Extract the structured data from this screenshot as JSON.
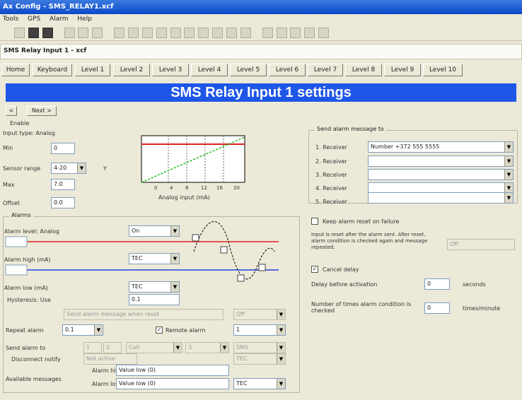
{
  "window": {
    "title": "Ax Config - SMS_RELAY1.xcf"
  },
  "menu": [
    "Tools",
    "GPS",
    "Alarm",
    "Help"
  ],
  "path_text": "SMS Relay Input 1 - xcf",
  "tabs": [
    "Home",
    "Keyboard",
    "Level 1",
    "Level 2",
    "Level 3",
    "Level 4",
    "Level 5",
    "Level 6",
    "Level 7",
    "Level 8",
    "Level 9",
    "Level 10"
  ],
  "banner": "SMS Relay Input 1 settings",
  "nav": {
    "prev": "<",
    "next": "Next >"
  },
  "left": {
    "enable_label": "Enable",
    "type_label": "Input type: Analog",
    "scale": [
      {
        "label": "Min",
        "value": "0"
      },
      {
        "label": "Sensor range",
        "value": "4-20"
      },
      {
        "label": "Max",
        "value": "7.0"
      },
      {
        "label": "Offset",
        "value": "0.0"
      }
    ],
    "graph": {
      "xlabel": "Analog input (mA)",
      "ylabel": "Y",
      "xticks": [
        "0",
        "4",
        "8",
        "12",
        "16",
        "20"
      ]
    }
  },
  "alarms": {
    "title": "Alarms",
    "mode_label": "Alarm level: Analog",
    "mode_value": "On",
    "high_label": "Alarm high (mA)",
    "high_delay": "TEC",
    "low_label": "Alarm low (mA)",
    "low_delay": "TEC",
    "hysteresis_label": "Hysteresis: Use",
    "hysteresis_value": "0.1",
    "disabled_msg": "Send alarm message when reset",
    "disabled_val": "Off",
    "repeat_label": "Repeat alarm",
    "repeat_value": "0.1",
    "remote_label": "Remote alarm",
    "remote_value": "1",
    "send_label": "Send alarm to",
    "send_options": [
      "1",
      "2",
      "Call",
      "3",
      "SMS"
    ],
    "notify_label": "Disconnect notify",
    "notify_value": "Not active",
    "notify_extra": "TEC",
    "msg_label": "Available messages",
    "msg_high_label": "Alarm high",
    "msg_high": "Value low (0)",
    "msg_low_label": "Alarm low",
    "msg_low": "Value low (0)",
    "msg_low_sel": "TEC"
  },
  "send": {
    "title": "Send alarm message to",
    "rows": [
      {
        "label": "1. Receiver",
        "value": "Number +372 555 5555"
      },
      {
        "label": "2. Receiver",
        "value": ""
      },
      {
        "label": "3. Receiver",
        "value": ""
      },
      {
        "label": "4. Receiver",
        "value": ""
      },
      {
        "label": "5. Receiver",
        "value": ""
      }
    ]
  },
  "right": {
    "keep_label": "Keep alarm reset on failure",
    "note": "Input is reset after the alarm sent. After reset, alarm condition is checked again and message repeated.",
    "note_value": "Off",
    "cancel_label": "Cancel delay",
    "delay_label": "Delay before activation",
    "delay_value": "0",
    "delay_unit": "seconds",
    "count_label": "Number of times alarm condition is checked",
    "count_value": "0",
    "count_unit": "times/minute"
  },
  "colors": {
    "banner": "#1e56e8",
    "high_line": "#e02020",
    "low_line": "#2040e0",
    "ramp": "#20c020"
  }
}
